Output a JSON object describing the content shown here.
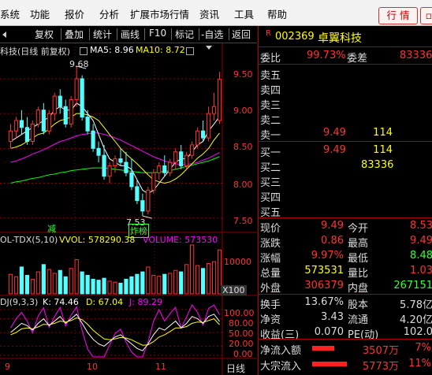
{
  "menu": {
    "items": [
      "系统",
      "功能",
      "报价",
      "分析",
      "扩展市场行情",
      "资讯",
      "工具",
      "帮助"
    ],
    "right": [
      "行",
      "情"
    ]
  },
  "toolbar": {
    "items": [
      "复权",
      "叠加",
      "统计",
      "画线",
      "F10",
      "标记",
      "-自选",
      "返回"
    ]
  },
  "chart": {
    "title": "科技(日线 前复权)",
    "ma5_label": "MA5: 8.96",
    "ma10_label": "MA10: 8.72",
    "price_ticks": [
      "9.50",
      "9.00",
      "8.50",
      "8.00",
      "7.50"
    ],
    "high_label": "9.68",
    "low_label": "7.53",
    "tag_jian": "减",
    "tag_zha": "炸榜",
    "vol_header": {
      "name": "OL-TDX(5,10)",
      "vvol": "VVOL: 578290.38",
      "volume": "VOLUME: 573530"
    },
    "vol_ticks": [
      "10000",
      "X100"
    ],
    "kdj_header": {
      "name": "DJ(9,3,3)",
      "k": "K: 74.46",
      "d": "D: 67.04",
      "j": "J: 89.29"
    },
    "kdj_ticks": [
      "100.00",
      "80.00",
      "50.00",
      "20.00",
      "0.00"
    ],
    "x_ticks": [
      "9",
      "10",
      "11"
    ],
    "period_label": "日线",
    "colors": {
      "up": "#ff3232",
      "down": "#54ffff",
      "ma5": "#ffffff",
      "ma10": "#ffff00",
      "ma20": "#ff00ff",
      "ma60": "#00ff00",
      "grid": "#8b0000"
    },
    "candles": [
      {
        "o": 8.6,
        "h": 8.85,
        "l": 8.5,
        "c": 8.75
      },
      {
        "o": 8.75,
        "h": 8.95,
        "l": 8.65,
        "c": 8.9
      },
      {
        "o": 8.9,
        "h": 9.05,
        "l": 8.7,
        "c": 8.8
      },
      {
        "o": 8.8,
        "h": 8.95,
        "l": 8.55,
        "c": 8.6
      },
      {
        "o": 8.6,
        "h": 8.9,
        "l": 8.55,
        "c": 8.85
      },
      {
        "o": 8.85,
        "h": 9.1,
        "l": 8.8,
        "c": 9.05
      },
      {
        "o": 9.05,
        "h": 9.15,
        "l": 8.7,
        "c": 8.75
      },
      {
        "o": 8.75,
        "h": 9.05,
        "l": 8.7,
        "c": 9.0
      },
      {
        "o": 9.0,
        "h": 9.3,
        "l": 8.9,
        "c": 9.25
      },
      {
        "o": 9.25,
        "h": 9.35,
        "l": 9.0,
        "c": 9.1
      },
      {
        "o": 9.1,
        "h": 9.2,
        "l": 8.8,
        "c": 8.85
      },
      {
        "o": 8.85,
        "h": 9.25,
        "l": 8.8,
        "c": 9.2
      },
      {
        "o": 9.2,
        "h": 9.68,
        "l": 9.1,
        "c": 9.5
      },
      {
        "o": 9.5,
        "h": 9.55,
        "l": 8.9,
        "c": 8.95
      },
      {
        "o": 8.95,
        "h": 9.05,
        "l": 8.7,
        "c": 8.75
      },
      {
        "o": 8.75,
        "h": 8.85,
        "l": 8.45,
        "c": 8.5
      },
      {
        "o": 8.5,
        "h": 8.6,
        "l": 8.3,
        "c": 8.4
      },
      {
        "o": 8.4,
        "h": 8.55,
        "l": 8.05,
        "c": 8.1
      },
      {
        "o": 8.1,
        "h": 8.3,
        "l": 8.0,
        "c": 8.25
      },
      {
        "o": 8.25,
        "h": 8.4,
        "l": 8.15,
        "c": 8.35
      },
      {
        "o": 8.35,
        "h": 8.5,
        "l": 8.25,
        "c": 8.3
      },
      {
        "o": 8.3,
        "h": 8.45,
        "l": 8.1,
        "c": 8.15
      },
      {
        "o": 8.15,
        "h": 8.35,
        "l": 7.9,
        "c": 7.95
      },
      {
        "o": 7.95,
        "h": 8.05,
        "l": 7.7,
        "c": 7.75
      },
      {
        "o": 7.75,
        "h": 7.85,
        "l": 7.53,
        "c": 7.6
      },
      {
        "o": 7.6,
        "h": 7.95,
        "l": 7.55,
        "c": 7.9
      },
      {
        "o": 7.9,
        "h": 8.2,
        "l": 7.85,
        "c": 8.15
      },
      {
        "o": 8.15,
        "h": 8.3,
        "l": 8.05,
        "c": 8.25
      },
      {
        "o": 8.25,
        "h": 8.4,
        "l": 8.1,
        "c": 8.15
      },
      {
        "o": 8.15,
        "h": 8.35,
        "l": 8.1,
        "c": 8.3
      },
      {
        "o": 8.3,
        "h": 8.5,
        "l": 8.2,
        "c": 8.45
      },
      {
        "o": 8.45,
        "h": 8.55,
        "l": 8.2,
        "c": 8.25
      },
      {
        "o": 8.25,
        "h": 8.45,
        "l": 8.2,
        "c": 8.4
      },
      {
        "o": 8.4,
        "h": 8.6,
        "l": 8.35,
        "c": 8.55
      },
      {
        "o": 8.55,
        "h": 8.8,
        "l": 8.5,
        "c": 8.75
      },
      {
        "o": 8.75,
        "h": 8.9,
        "l": 8.6,
        "c": 8.65
      },
      {
        "o": 8.65,
        "h": 9.1,
        "l": 8.6,
        "c": 9.0
      },
      {
        "o": 9.0,
        "h": 9.3,
        "l": 8.9,
        "c": 9.1
      },
      {
        "o": 8.9,
        "h": 9.6,
        "l": 8.85,
        "c": 9.49
      }
    ],
    "volumes": [
      40,
      35,
      55,
      38,
      30,
      45,
      60,
      50,
      42,
      48,
      35,
      52,
      70,
      45,
      38,
      30,
      28,
      32,
      26,
      24,
      22,
      30,
      35,
      40,
      45,
      55,
      38,
      36,
      40,
      42,
      48,
      45,
      60,
      100,
      58,
      52,
      62,
      66,
      90
    ],
    "ma5": [
      8.6,
      8.65,
      8.7,
      8.75,
      8.8,
      8.85,
      8.9,
      8.95,
      9.05,
      9.1,
      9.05,
      9.05,
      9.15,
      9.1,
      9.0,
      8.9,
      8.7,
      8.5,
      8.35,
      8.3,
      8.25,
      8.25,
      8.2,
      8.05,
      7.9,
      7.85,
      7.9,
      8.0,
      8.1,
      8.2,
      8.3,
      8.35,
      8.35,
      8.45,
      8.55,
      8.6,
      8.75,
      8.85,
      8.96
    ],
    "ma10": [
      8.5,
      8.52,
      8.55,
      8.6,
      8.65,
      8.7,
      8.72,
      8.78,
      8.85,
      8.9,
      8.92,
      8.95,
      9.0,
      9.0,
      8.98,
      8.95,
      8.9,
      8.8,
      8.7,
      8.6,
      8.5,
      8.42,
      8.35,
      8.28,
      8.2,
      8.12,
      8.05,
      8.02,
      8.0,
      8.02,
      8.06,
      8.12,
      8.2,
      8.28,
      8.36,
      8.42,
      8.5,
      8.62,
      8.72
    ],
    "ma20": [
      8.3,
      8.32,
      8.35,
      8.38,
      8.42,
      8.45,
      8.48,
      8.52,
      8.56,
      8.6,
      8.62,
      8.65,
      8.68,
      8.7,
      8.71,
      8.72,
      8.72,
      8.7,
      8.68,
      8.65,
      8.62,
      8.58,
      8.54,
      8.5,
      8.46,
      8.42,
      8.38,
      8.35,
      8.32,
      8.3,
      8.28,
      8.27,
      8.27,
      8.28,
      8.3,
      8.33,
      8.36,
      8.4,
      8.44
    ],
    "ma60": [
      8.0,
      8.02,
      8.03,
      8.05,
      8.07,
      8.08,
      8.1,
      8.12,
      8.13,
      8.15,
      8.16,
      8.18,
      8.19,
      8.2,
      8.21,
      8.22,
      8.22,
      8.22,
      8.21,
      8.2,
      8.19,
      8.18,
      8.17,
      8.16,
      8.15,
      8.15,
      8.15,
      8.16,
      8.17,
      8.18,
      8.2,
      8.22,
      8.24,
      8.26,
      8.28,
      8.3,
      8.32,
      8.35,
      8.38
    ],
    "kdj_k": [
      50,
      60,
      70,
      65,
      55,
      70,
      80,
      65,
      75,
      85,
      70,
      80,
      90,
      70,
      50,
      35,
      25,
      20,
      30,
      40,
      45,
      35,
      25,
      15,
      10,
      25,
      45,
      60,
      55,
      65,
      75,
      60,
      70,
      85,
      80,
      70,
      85,
      90,
      74
    ],
    "kdj_d": [
      45,
      50,
      58,
      60,
      58,
      62,
      68,
      67,
      70,
      75,
      73,
      76,
      82,
      78,
      68,
      55,
      45,
      36,
      34,
      36,
      39,
      38,
      34,
      28,
      22,
      23,
      30,
      40,
      45,
      52,
      60,
      60,
      63,
      70,
      73,
      72,
      76,
      80,
      67
    ],
    "kdj_j": [
      60,
      80,
      94,
      75,
      49,
      86,
      104,
      61,
      85,
      105,
      64,
      88,
      106,
      54,
      14,
      -5,
      -15,
      -12,
      22,
      48,
      57,
      29,
      7,
      -11,
      -14,
      29,
      75,
      100,
      75,
      91,
      105,
      60,
      84,
      115,
      94,
      66,
      103,
      110,
      89
    ]
  },
  "quote": {
    "code_prefix": "R",
    "code": "002369",
    "name": "卓翼科技",
    "weibi_label": "委比",
    "weibi_value": "99.73%",
    "weicha_label": "委差",
    "weicha_value": "83336",
    "sell": [
      {
        "label": "卖五",
        "price": "",
        "vol": ""
      },
      {
        "label": "卖四",
        "price": "",
        "vol": ""
      },
      {
        "label": "卖三",
        "price": "",
        "vol": ""
      },
      {
        "label": "卖二",
        "price": "",
        "vol": ""
      },
      {
        "label": "卖一",
        "price": "9.49",
        "vol": "114"
      }
    ],
    "buy": [
      {
        "label": "买一",
        "price": "9.49",
        "vol": "114"
      },
      {
        "label": "买二",
        "price": "",
        "vol": "83336"
      },
      {
        "label": "买三",
        "price": "",
        "vol": ""
      },
      {
        "label": "买四",
        "price": "",
        "vol": ""
      },
      {
        "label": "买五",
        "price": "",
        "vol": ""
      }
    ],
    "stats": [
      {
        "l1": "现价",
        "v1": "9.49",
        "l2": "今开",
        "v2": "8.53"
      },
      {
        "l1": "涨跌",
        "v1": "0.86",
        "l2": "最高",
        "v2": "9.49"
      },
      {
        "l1": "涨幅",
        "v1": "9.97%",
        "l2": "最低",
        "v2": "8.48"
      },
      {
        "l1": "总量",
        "v1": "573531",
        "l2": "量比",
        "v2": "1.03"
      },
      {
        "l1": "外盘",
        "v1": "306379",
        "l2": "内盘",
        "v2": "267151"
      }
    ],
    "stats2": [
      {
        "l1": "换手",
        "v1": "13.67%",
        "l2": "股本",
        "v2": "5.78亿"
      },
      {
        "l1": "净资",
        "v1": "3.43",
        "l2": "流通",
        "v2": "4.20亿"
      },
      {
        "l1": "收益(三)",
        "v1": "0.070",
        "l2": "PE(动)",
        "v2": "102.0"
      }
    ],
    "flows": [
      {
        "label": "净流入额",
        "value": "3507万",
        "pct": "7%",
        "bar_fraction": 0.35
      },
      {
        "label": "大宗流入",
        "value": "5773万",
        "pct": "11%",
        "bar_fraction": 0.55
      }
    ]
  }
}
